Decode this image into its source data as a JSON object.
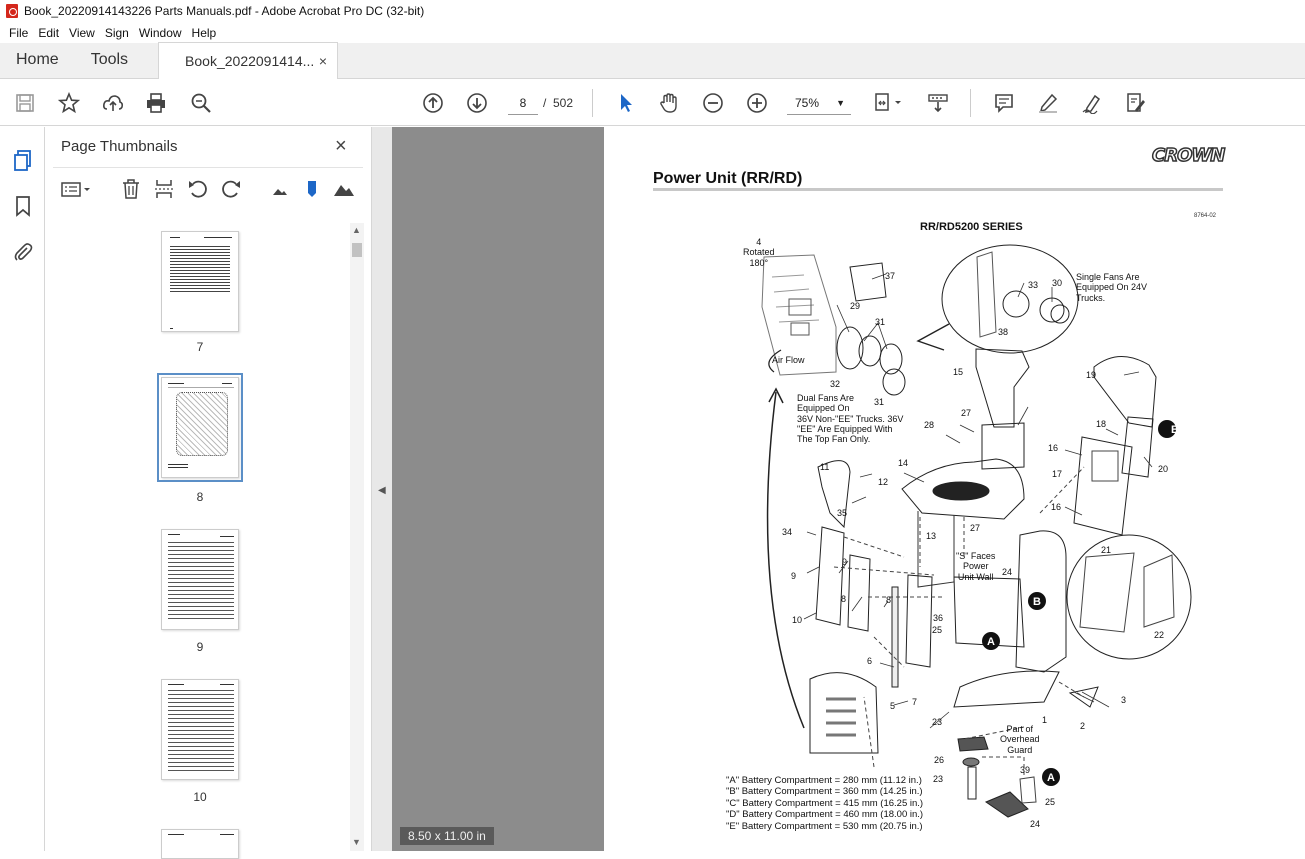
{
  "window": {
    "title": "Book_20220914143226 Parts Manuals.pdf - Adobe Acrobat Pro DC (32-bit)"
  },
  "menu": {
    "items": [
      "File",
      "Edit",
      "View",
      "Sign",
      "Window",
      "Help"
    ]
  },
  "tabs": {
    "home": "Home",
    "tools": "Tools",
    "doc": "Book_2022091414...",
    "doc_close": "×"
  },
  "toolbar": {
    "page_current": "8",
    "page_sep": "/",
    "page_total": "502",
    "zoom": "75%"
  },
  "thumbnails": {
    "title": "Page Thumbnails",
    "close": "×",
    "pages": [
      {
        "label": "7"
      },
      {
        "label": "8",
        "selected": true
      },
      {
        "label": "9"
      },
      {
        "label": "10"
      }
    ]
  },
  "page_size": "8.50 x 11.00 in",
  "document": {
    "brand": "CROWN",
    "title": "Power Unit (RR/RD)",
    "series": "RR/RD5200 SERIES",
    "figure_code": "8764-02",
    "labels": {
      "rotated": "4\nRotated\n180°",
      "single_fans": "Single Fans Are\nEquipped On 24V\nTrucks.",
      "air_flow": "Air Flow",
      "dual_fans": "Dual Fans Are\nEquipped On\n36V Non-\"EE\" Trucks. 36V\n\"EE\" Are Equipped With\nThe Top Fan Only.",
      "s_faces": "\"S\" Faces\nPower\nUnit Wall",
      "overhead": "Part of\nOverhead\nGuard"
    },
    "callouts": [
      "37",
      "33",
      "30",
      "29",
      "31",
      "38",
      "32",
      "31",
      "15",
      "19",
      "28",
      "27",
      "18",
      "16",
      "17",
      "20",
      "14",
      "11",
      "12",
      "35",
      "34",
      "13",
      "27",
      "16",
      "21",
      "9",
      "9",
      "24",
      "8",
      "8",
      "36",
      "25",
      "10",
      "6",
      "5",
      "7",
      "23",
      "22",
      "3",
      "2",
      "1",
      "26",
      "23",
      "39",
      "25",
      "24"
    ],
    "markers": [
      "B",
      "B",
      "A",
      "A"
    ],
    "battery": [
      "\"A\" Battery Compartment = 280 mm (11.12 in.)",
      "\"B\" Battery Compartment = 360 mm (14.25 in.)",
      "\"C\" Battery Compartment = 415 mm (16.25 in.)",
      "\"D\" Battery Compartment = 460 mm (18.00 in.)",
      "\"E\" Battery Compartment = 530 mm (20.75 in.)"
    ]
  }
}
